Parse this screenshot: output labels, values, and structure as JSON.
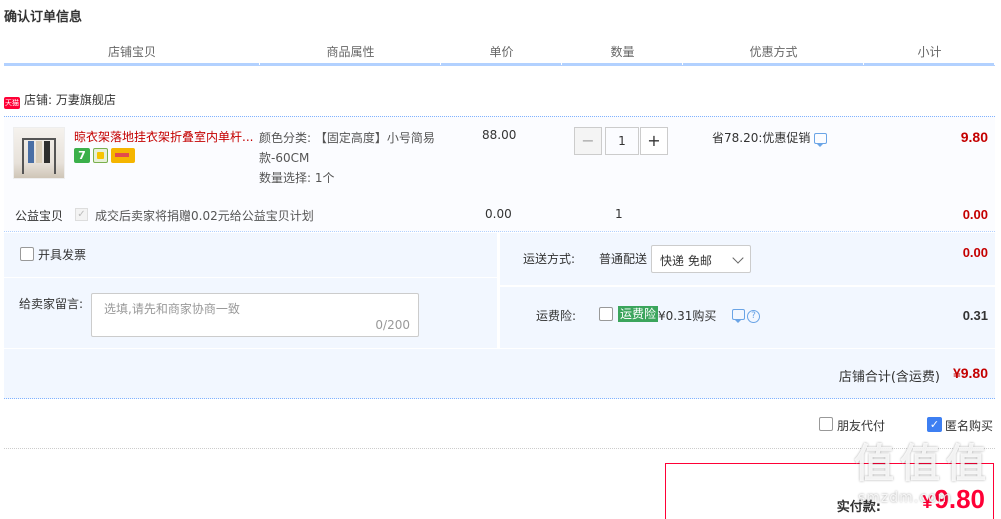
{
  "page": {
    "title": "确认订单信息"
  },
  "columns": [
    "店铺宝贝",
    "商品属性",
    "单价",
    "数量",
    "优惠方式",
    "小计"
  ],
  "shop": {
    "badge": "天猫",
    "label": "店铺: 万妻旗舰店"
  },
  "item": {
    "title": "晾衣架落地挂衣架折叠室内单杆...",
    "badge_7": "7",
    "attr_color": "颜色分类: 【固定高度】小号简易款-60CM",
    "attr_qty": "数量选择: 1个",
    "price": "88.00",
    "qty": "1",
    "minus": "−",
    "plus": "+",
    "discount": "省78.20:优惠促销",
    "subtotal": "9.80"
  },
  "charity": {
    "label": "公益宝贝",
    "check": "✓",
    "text": "成交后卖家将捐赠0.02元给公益宝贝计划",
    "price": "0.00",
    "qty": "1",
    "total": "0.00"
  },
  "invoice": {
    "label": "开具发票"
  },
  "message": {
    "label": "给卖家留言:",
    "placeholder": "选填,请先和商家协商一致",
    "count": "0/200"
  },
  "shipping": {
    "label": "运送方式:",
    "type": "普通配送",
    "selected": "快递 免邮",
    "fee": "0.00"
  },
  "insurance": {
    "label": "运费险:",
    "tag": "运费险",
    "price": "¥0.31购买",
    "help": "?",
    "fee": "0.31"
  },
  "shop_total": {
    "label": "店铺合计(含运费)",
    "value": "¥9.80"
  },
  "pay_options": {
    "friend": "朋友代付",
    "anon": "匿名购买",
    "anon_checked": "✓"
  },
  "final": {
    "label": "实付款:",
    "yen": "¥",
    "value": "9.80"
  },
  "watermark": {
    "glyph": "值",
    "sub": "smzdm.com"
  }
}
